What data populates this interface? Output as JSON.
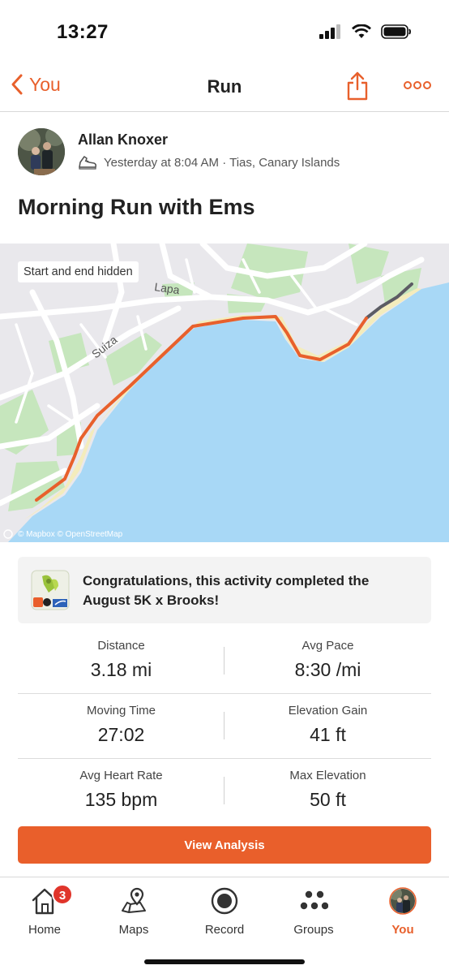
{
  "status_bar": {
    "time": "13:27"
  },
  "nav": {
    "back_label": "You",
    "title": "Run"
  },
  "athlete": {
    "name": "Allan Knoxer",
    "meta": "Yesterday at 8:04 AM · Tias, Canary Islands"
  },
  "activity": {
    "title": "Morning Run with Ems"
  },
  "map": {
    "hidden_label": "Start and end hidden",
    "place_labels": [
      "Lapa",
      "Suiza"
    ],
    "credit": "© Mapbox © OpenStreetMap",
    "route_color": "#e8602c",
    "hidden_route_color": "#5c5c64",
    "water_color": "#a8d8f6",
    "beach_color": "#f4ecbc",
    "park_color": "#c6e6bd"
  },
  "challenge": {
    "text": "Congratulations, this activity completed the August 5K x Brooks!"
  },
  "stats": [
    {
      "left_label": "Distance",
      "left_value": "3.18 mi",
      "right_label": "Avg Pace",
      "right_value": "8:30 /mi"
    },
    {
      "left_label": "Moving Time",
      "left_value": "27:02",
      "right_label": "Elevation Gain",
      "right_value": "41 ft"
    },
    {
      "left_label": "Avg Heart Rate",
      "left_value": "135 bpm",
      "right_label": "Max Elevation",
      "right_value": "50 ft"
    }
  ],
  "analysis_button": {
    "label": "View Analysis"
  },
  "tabbar": {
    "items": [
      {
        "label": "Home",
        "icon": "home-icon",
        "badge": "3"
      },
      {
        "label": "Maps",
        "icon": "map-pin-icon"
      },
      {
        "label": "Record",
        "icon": "record-icon"
      },
      {
        "label": "Groups",
        "icon": "groups-icon"
      },
      {
        "label": "You",
        "icon": "profile-avatar",
        "active": true
      }
    ]
  },
  "colors": {
    "accent": "#e8602c",
    "badge": "#e0352b"
  }
}
